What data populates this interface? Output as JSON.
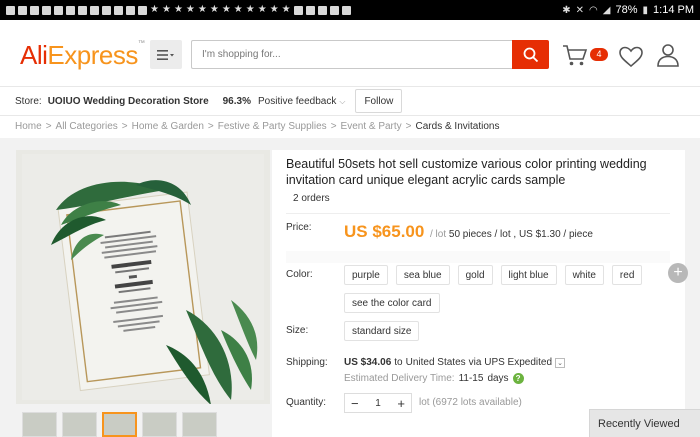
{
  "status_bar": {
    "battery": "78%",
    "time": "1:14 PM"
  },
  "header": {
    "logo_ali": "Ali",
    "logo_express": "Express",
    "search_placeholder": "I'm shopping for...",
    "cart_count": "4"
  },
  "store": {
    "label": "Store:",
    "name": "UOIUO Wedding Decoration Store",
    "rating": "96.3%",
    "feedback_label": "Positive feedback",
    "follow_label": "Follow"
  },
  "breadcrumb": [
    "Home",
    "All Categories",
    "Home & Garden",
    "Festive & Party Supplies",
    "Event & Party",
    "Cards & Invitations"
  ],
  "product": {
    "title": "Beautiful 50sets hot sell customize various color printing wedding invitation card unique elegant acrylic cards sample",
    "orders": "2 orders",
    "price_label": "Price:",
    "price": "US $65.00",
    "price_unit_lot": "/ lot",
    "price_unit_detail": "50 pieces / lot , US $1.30 / piece",
    "color_label": "Color:",
    "colors": [
      "purple",
      "sea blue",
      "gold",
      "light blue",
      "white",
      "red",
      "see the color card"
    ],
    "size_label": "Size:",
    "size": "standard size",
    "shipping_label": "Shipping:",
    "shipping_cost": "US $34.06",
    "shipping_to": "to",
    "shipping_country": "United States",
    "shipping_via": "via UPS Expedited",
    "delivery_label": "Estimated Delivery Time:",
    "delivery_days": "11-15",
    "delivery_unit": "days",
    "quantity_label": "Quantity:",
    "quantity": "1",
    "lots_available": "lot (6972 lots available)"
  },
  "recently_viewed": "Recently Viewed"
}
